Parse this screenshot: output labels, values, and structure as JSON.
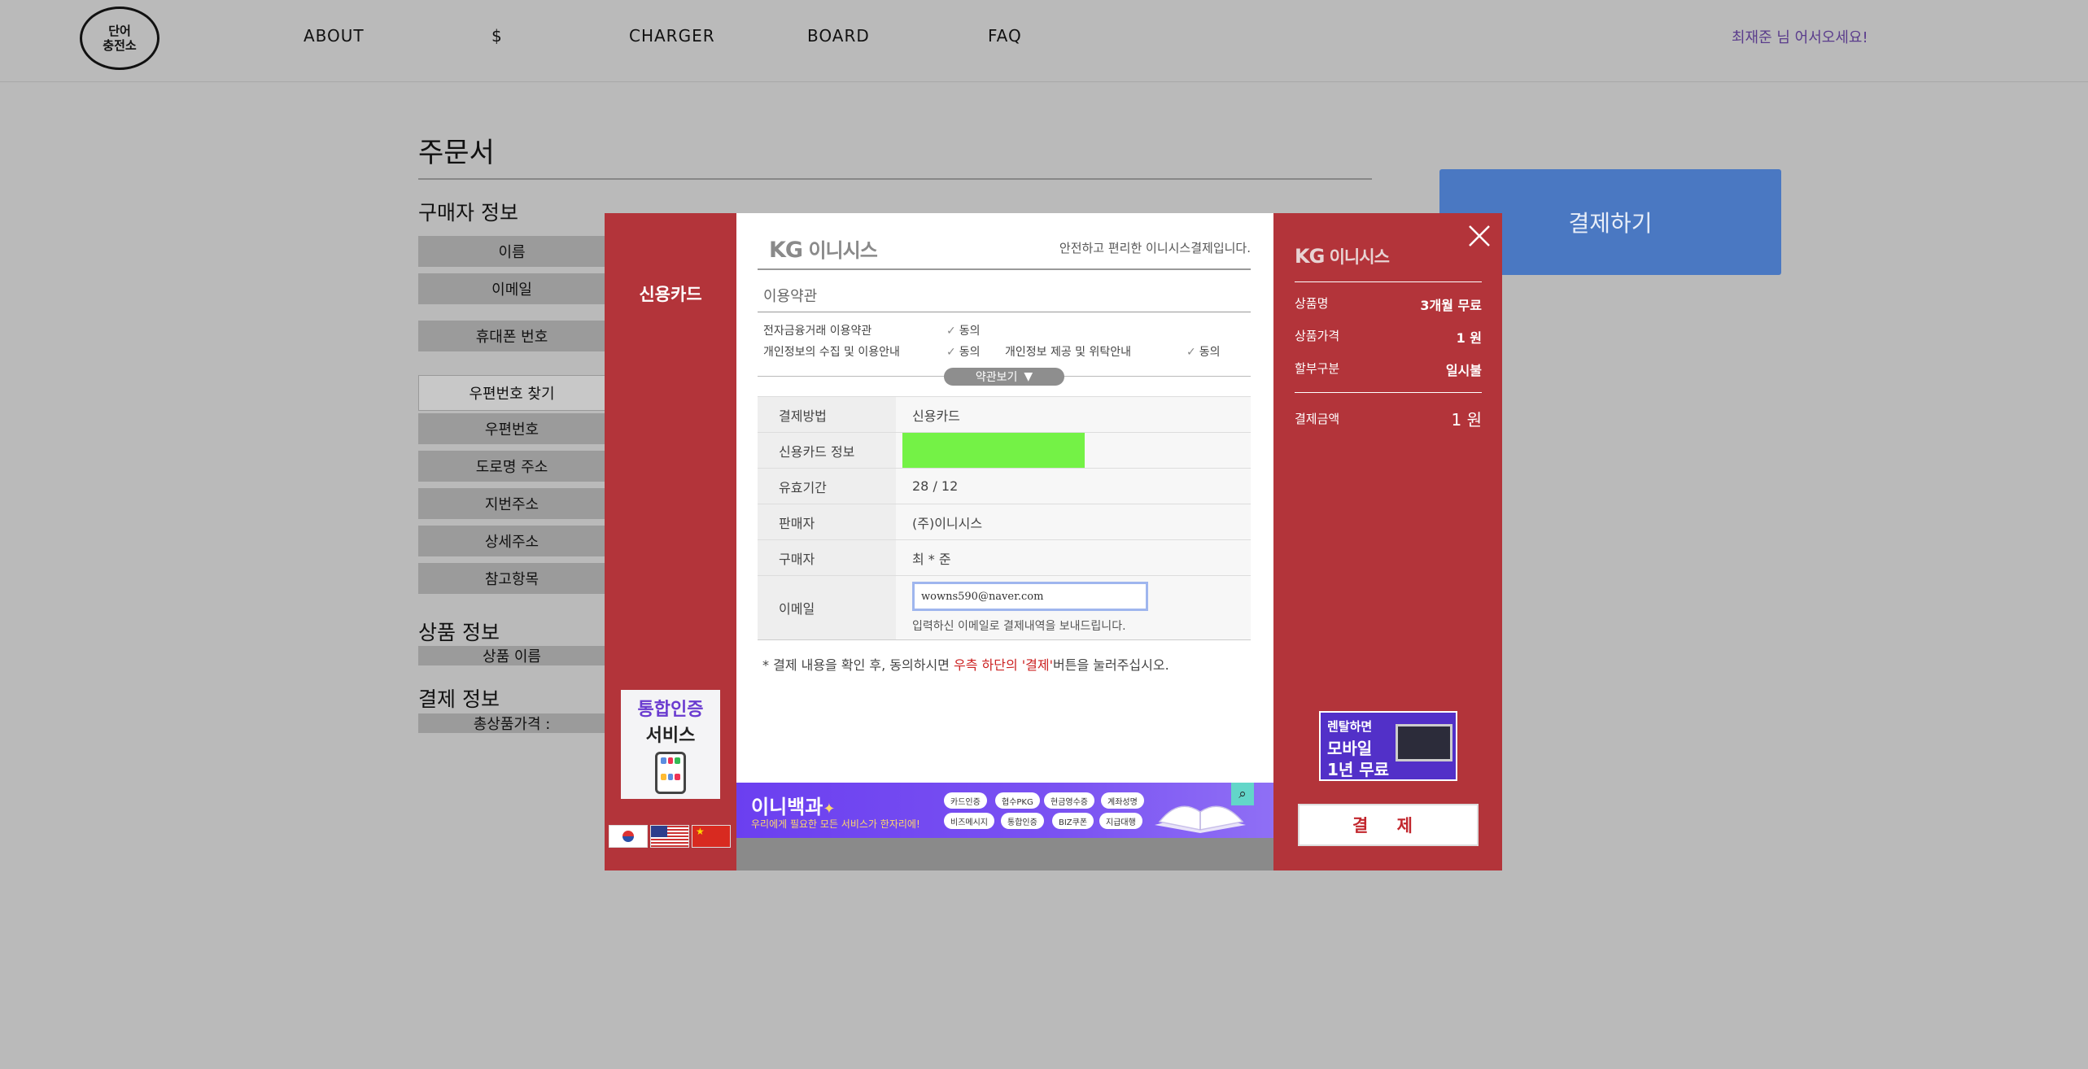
{
  "nav": {
    "logo_line1": "단어",
    "logo_line2": "충전소",
    "items": [
      "ABOUT",
      "$",
      "CHARGER",
      "BOARD",
      "FAQ"
    ],
    "welcome": "최재준 님 어서오세요!"
  },
  "order": {
    "title": "주문서",
    "buyer_section": "구매자 정보",
    "buyer_fields": [
      "이름",
      "이메일",
      "휴대폰 번호"
    ],
    "postcode_button": "우편번호 찾기",
    "address_fields": [
      "우편번호",
      "도로명 주소",
      "지번주소",
      "상세주소",
      "참고항목"
    ],
    "product_section": "상품 정보",
    "product_field": "상품 이름",
    "payment_section": "결제 정보",
    "total_field": "총상품가격 :",
    "pay_button": "결제하기"
  },
  "modal": {
    "left": {
      "method_title": "신용카드",
      "ad_line1": "통합인증",
      "ad_line2": "서비스"
    },
    "center": {
      "logo_kg": "KG",
      "logo_name": "이니시스",
      "slogan": "안전하고 편리한 이니시스결제입니다.",
      "terms_title": "이용약관",
      "terms": [
        {
          "label": "전자금융거래 이용약관",
          "agree": "동의"
        },
        {
          "label": "개인정보의 수집 및 이용안내",
          "agree": "동의"
        },
        {
          "label": "개인정보 제공 및 위탁안내",
          "agree": "동의"
        }
      ],
      "terms_button": "약관보기",
      "rows": [
        {
          "key": "결제방법",
          "value": "신용카드"
        },
        {
          "key": "신용카드 정보",
          "value": ""
        },
        {
          "key": "유효기간",
          "value": "28 / 12"
        },
        {
          "key": "판매자",
          "value": "(주)이니시스"
        },
        {
          "key": "구매자",
          "value": "최 * 준"
        },
        {
          "key": "이메일",
          "value": "wowns590@naver.com"
        }
      ],
      "email_note": "입력하신 이메일로 결제내역을 보내드립니다.",
      "notice_prefix": "결제 내용을 확인 후, 동의하시면",
      "notice_highlight": "우측 하단의 '결제'",
      "notice_suffix": "버튼을 눌러주십시오.",
      "banner_title": "이니백과",
      "banner_sub": "우리에게 필요한 모든 서비스가 한자리에!",
      "banner_pills": [
        "카드인증",
        "협수PKG",
        "현금영수증",
        "계좌성명",
        "비즈메시지",
        "통합인증",
        "BIZ쿠폰",
        "지급대행"
      ]
    },
    "right": {
      "logo_kg": "KG",
      "logo_name": "이니시스",
      "summary": [
        {
          "label": "상품명",
          "value": "3개월 무료"
        },
        {
          "label": "상품가격",
          "value": "1 원"
        },
        {
          "label": "할부구분",
          "value": "일시불"
        }
      ],
      "total_label": "결제금액",
      "total_value": "1 원",
      "ad_line1": "렌탈하면",
      "ad_line2": "모바일",
      "ad_line3": "1년 무료",
      "pay_button": "결 제"
    }
  },
  "colors": {
    "modal_red": "#b3343a",
    "pay_blue": "#4a78c2",
    "masked_green": "#74f246",
    "banner_purple": "#6b3ff0"
  }
}
